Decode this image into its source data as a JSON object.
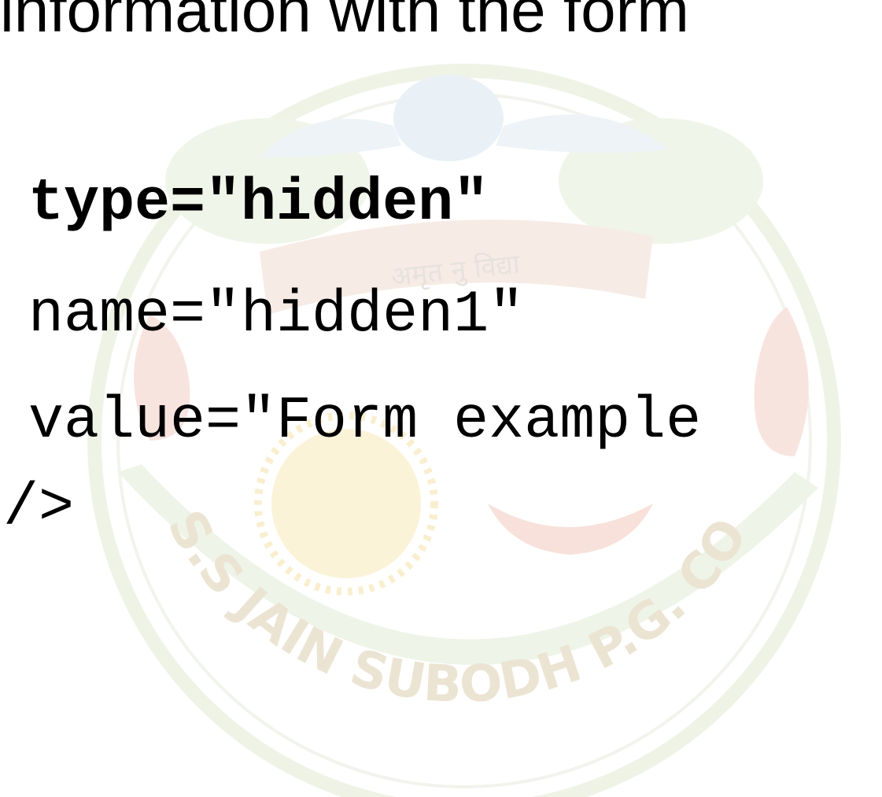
{
  "slide": {
    "heading": "information with the form",
    "code_lines": [
      "type=\"hidden\"",
      "name=\"hidden1\"",
      "value=\"Form example",
      "/>"
    ]
  },
  "watermark": {
    "logo": "college-seal",
    "motto": "अमृत नु विद्या",
    "ring_text": "S.S JAIN SUBODH P.G. COLLEGE",
    "colors": {
      "ring": "#eef3e6",
      "ring_text": "#eadfc8",
      "ribbon": "#f6e0d8",
      "sun": "#f8edc6",
      "green": "#e6f0dc",
      "bird": "#e4eef4"
    }
  }
}
